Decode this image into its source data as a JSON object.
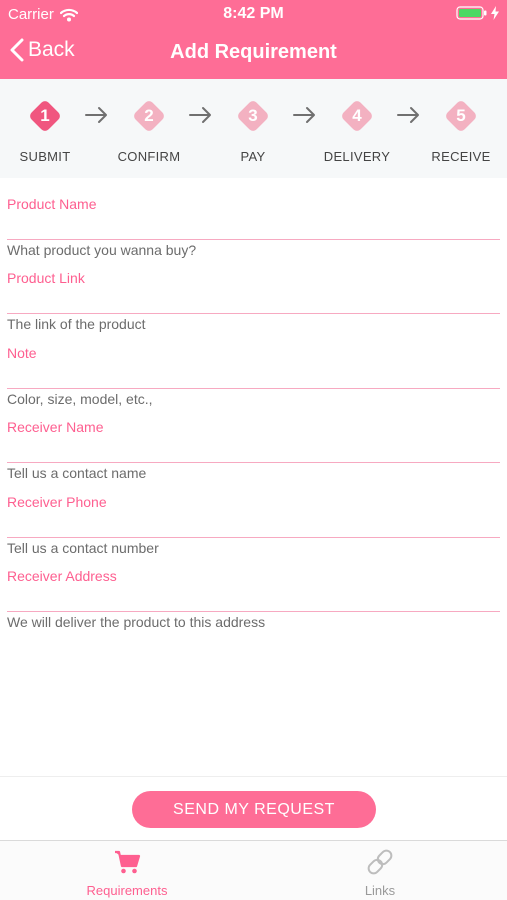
{
  "status_bar": {
    "carrier": "Carrier",
    "time": "8:42 PM"
  },
  "nav": {
    "back_label": "Back",
    "title": "Add Requirement"
  },
  "steps": [
    {
      "number": "1",
      "label": "SUBMIT",
      "active": true
    },
    {
      "number": "2",
      "label": "CONFIRM",
      "active": false
    },
    {
      "number": "3",
      "label": "PAY",
      "active": false
    },
    {
      "number": "4",
      "label": "DELIVERY",
      "active": false
    },
    {
      "number": "5",
      "label": "RECEIVE",
      "active": false
    }
  ],
  "form": {
    "fields": [
      {
        "label": "Product Name",
        "hint": "What product you wanna buy?"
      },
      {
        "label": "Product Link",
        "hint": "The link of the product"
      },
      {
        "label": "Note",
        "hint": "Color, size, model, etc.,"
      },
      {
        "label": "Receiver Name",
        "hint": "Tell us a contact name"
      },
      {
        "label": "Receiver Phone",
        "hint": "Tell us a contact number"
      },
      {
        "label": "Receiver Address",
        "hint": "We will deliver the product to this address"
      }
    ],
    "submit_label": "SEND MY REQUEST"
  },
  "tabbar": {
    "tabs": [
      {
        "label": "Requirements",
        "icon": "cart-icon",
        "selected": true
      },
      {
        "label": "Links",
        "icon": "link-icon",
        "selected": false
      }
    ]
  },
  "colors": {
    "brand": "#fe6d96",
    "step_active": "#f0567f",
    "step_inactive": "#f3b1c1",
    "field_label": "#fe5f90",
    "tab_selected": "#fe5f90",
    "tab_unselected": "#9a9a9a"
  }
}
